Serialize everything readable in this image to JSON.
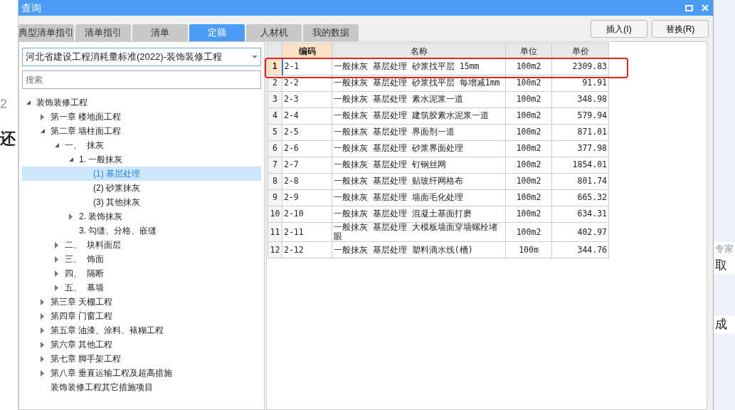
{
  "backdrop": {
    "left_texts": [
      "2",
      "还"
    ],
    "right_texts": [
      "专家",
      "取",
      "成"
    ]
  },
  "window": {
    "title": "查询"
  },
  "tabs": [
    {
      "label": "典型清单指引",
      "selected": false
    },
    {
      "label": "清单指引",
      "selected": false
    },
    {
      "label": "清单",
      "selected": false
    },
    {
      "label": "定额",
      "selected": true
    },
    {
      "label": "人材机",
      "selected": false
    },
    {
      "label": "我的数据",
      "selected": false
    }
  ],
  "buttons": [
    "插入(I)",
    "替换(R)"
  ],
  "library_select": {
    "value": "河北省建设工程消耗量标准(2022)-装饰装修工程"
  },
  "search": {
    "placeholder": "搜索"
  },
  "tree": [
    {
      "label": "装饰装修工程",
      "expanded": true,
      "selected": false,
      "children": [
        {
          "label": "第一章 楼地面工程",
          "expanded": false,
          "selected": false
        },
        {
          "label": "第二章 墙柱面工程",
          "expanded": true,
          "selected": false,
          "children": [
            {
              "label": "一、  抹灰",
              "expanded": true,
              "selected": false,
              "children": [
                {
                  "label": "1. 一般抹灰",
                  "expanded": true,
                  "selected": false,
                  "children": [
                    {
                      "label": "(1) 基层处理",
                      "selected": true
                    },
                    {
                      "label": "(2) 砂浆抹灰",
                      "selected": false
                    },
                    {
                      "label": "(3) 其他抹灰",
                      "selected": false
                    }
                  ]
                },
                {
                  "label": "2. 装饰抹灰",
                  "expanded": false,
                  "selected": false
                },
                {
                  "label": "3. 勾缝、分格、嵌缝",
                  "selected": false
                }
              ]
            },
            {
              "label": "二、  块料面层",
              "expanded": false,
              "selected": false
            },
            {
              "label": "三、  饰面",
              "expanded": false,
              "selected": false
            },
            {
              "label": "四、  隔断",
              "expanded": false,
              "selected": false
            },
            {
              "label": "五、  幕墙",
              "expanded": false,
              "selected": false
            }
          ]
        },
        {
          "label": "第三章 天棚工程",
          "expanded": false,
          "selected": false
        },
        {
          "label": "第四章 门窗工程",
          "expanded": false,
          "selected": false
        },
        {
          "label": "第五章 油漆、涂料、裱糊工程",
          "expanded": false,
          "selected": false
        },
        {
          "label": "第六章 其他工程",
          "expanded": false,
          "selected": false
        },
        {
          "label": "第七章 脚手架工程",
          "expanded": false,
          "selected": false
        },
        {
          "label": "第八章 垂直运输工程及超高措施",
          "expanded": false,
          "selected": false
        },
        {
          "label": "装饰装修工程其它措施项目",
          "selected": false
        }
      ]
    }
  ],
  "table": {
    "columns": [
      "编码",
      "名称",
      "单位",
      "单价"
    ],
    "rows": [
      {
        "index": "1",
        "code": "2-1",
        "name": "一般抹灰 基层处理 砂浆找平层 15mm",
        "unit": "100m2",
        "price": "2309.83",
        "selected": true,
        "circled": true
      },
      {
        "index": "2",
        "code": "2-2",
        "name": "一般抹灰 基层处理 砂浆找平层 每增减1mm",
        "unit": "100m2",
        "price": "91.91",
        "selected": false,
        "circled": false
      },
      {
        "index": "3",
        "code": "2-3",
        "name": "一般抹灰 基层处理 素水泥浆一道",
        "unit": "100m2",
        "price": "348.98",
        "selected": false,
        "circled": false
      },
      {
        "index": "4",
        "code": "2-4",
        "name": "一般抹灰 基层处理 建筑胶素水泥浆一道",
        "unit": "100m2",
        "price": "579.94",
        "selected": false,
        "circled": false
      },
      {
        "index": "5",
        "code": "2-5",
        "name": "一般抹灰 基层处理 界面剂一道",
        "unit": "100m2",
        "price": "871.01",
        "selected": false,
        "circled": false
      },
      {
        "index": "6",
        "code": "2-6",
        "name": "一般抹灰 基层处理 砂浆界面处理",
        "unit": "100m2",
        "price": "377.98",
        "selected": false,
        "circled": false
      },
      {
        "index": "7",
        "code": "2-7",
        "name": "一般抹灰 基层处理 钉钢丝网",
        "unit": "100m2",
        "price": "1854.01",
        "selected": false,
        "circled": false
      },
      {
        "index": "8",
        "code": "2-8",
        "name": "一般抹灰 基层处理 贴玻纤网格布",
        "unit": "100m2",
        "price": "801.74",
        "selected": false,
        "circled": false
      },
      {
        "index": "9",
        "code": "2-9",
        "name": "一般抹灰 基层处理 墙面毛化处理",
        "unit": "100m2",
        "price": "665.32",
        "selected": false,
        "circled": false
      },
      {
        "index": "10",
        "code": "2-10",
        "name": "一般抹灰 基层处理 混凝土基面打磨",
        "unit": "100m2",
        "price": "634.31",
        "selected": false,
        "circled": false
      },
      {
        "index": "11",
        "code": "2-11",
        "name": "一般抹灰 基层处理 大模板墙面穿墙螺栓堵眼",
        "unit": "100m2",
        "price": "402.97",
        "selected": false,
        "circled": false
      },
      {
        "index": "12",
        "code": "2-12",
        "name": "一般抹灰 基层处理 塑料滴水线(槽)",
        "unit": "100m",
        "price": "344.76",
        "selected": false,
        "circled": false
      }
    ]
  }
}
